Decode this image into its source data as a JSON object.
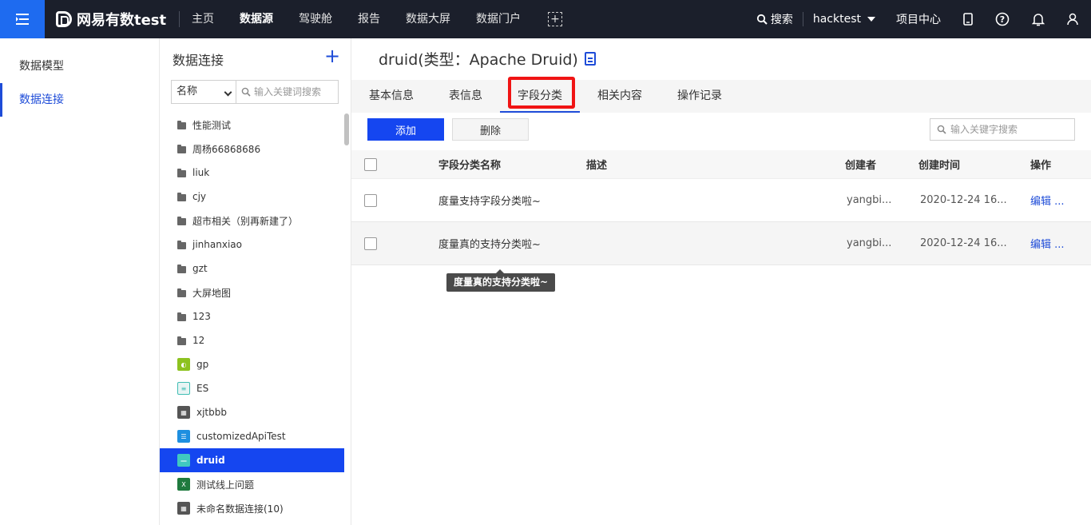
{
  "topbar": {
    "logo": "网易有数test",
    "nav": [
      "主页",
      "数据源",
      "驾驶舱",
      "报告",
      "数据大屏",
      "数据门户"
    ],
    "active_nav": "数据源",
    "search_label": "搜索",
    "user": "hacktest",
    "project_center": "项目中心"
  },
  "sidebar": {
    "items": [
      {
        "label": "数据模型"
      },
      {
        "label": "数据连接"
      }
    ]
  },
  "connections": {
    "title": "数据连接",
    "filter_value": "名称",
    "search_placeholder": "输入关键词搜索",
    "items": [
      {
        "label": "性能测试",
        "type": "folder"
      },
      {
        "label": "周杨66868686",
        "type": "folder"
      },
      {
        "label": "liuk",
        "type": "folder"
      },
      {
        "label": "cjy",
        "type": "folder"
      },
      {
        "label": "超市相关（别再新建了）",
        "type": "folder"
      },
      {
        "label": "jinhanxiao",
        "type": "folder"
      },
      {
        "label": "gzt",
        "type": "folder"
      },
      {
        "label": "大屏地图",
        "type": "folder"
      },
      {
        "label": "123",
        "type": "folder"
      },
      {
        "label": "12",
        "type": "folder"
      },
      {
        "label": "gp",
        "type": "greenplum",
        "color": "#8dc21f"
      },
      {
        "label": "ES",
        "type": "elasticsearch",
        "color": "#3fbdb3"
      },
      {
        "label": "xjtbbb",
        "type": "grid",
        "color": "#555555"
      },
      {
        "label": "customizedApiTest",
        "type": "api",
        "color": "#1e8fe0"
      },
      {
        "label": "druid",
        "type": "druid",
        "color": "#40c8c0"
      },
      {
        "label": "测试线上问题",
        "type": "excel",
        "color": "#1f7a3e"
      },
      {
        "label": "未命名数据连接(10)",
        "type": "grid",
        "color": "#555555"
      }
    ],
    "selected": "druid"
  },
  "main": {
    "title": "druid(类型：Apache Druid)",
    "tabs": [
      "基本信息",
      "表信息",
      "字段分类",
      "相关内容",
      "操作记录"
    ],
    "active_tab": "字段分类",
    "add_label": "添加",
    "delete_label": "删除",
    "search_placeholder": "输入关键字搜索",
    "table": {
      "headers": [
        "字段分类名称",
        "描述",
        "创建者",
        "创建时间",
        "操作"
      ],
      "rows": [
        {
          "name": "度量支持字段分类啦~",
          "desc": "",
          "creator": "yangbi...",
          "time": "2020-12-24 16...",
          "op": "编辑 ..."
        },
        {
          "name": "度量真的支持分类啦~",
          "desc": "",
          "creator": "yangbi...",
          "time": "2020-12-24 16...",
          "op": "编辑 ..."
        }
      ]
    },
    "tooltip": "度量真的支持分类啦~"
  },
  "colors": {
    "accent": "#1e4cd8",
    "topbar_bg": "#1b1f2b",
    "highlight": "#f01414"
  }
}
